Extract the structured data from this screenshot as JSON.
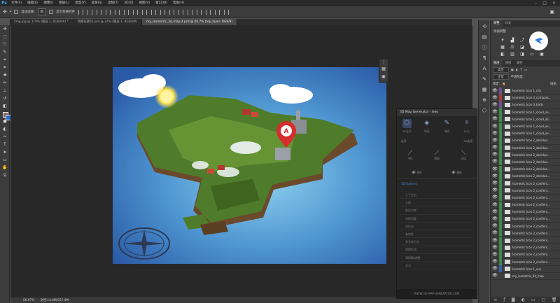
{
  "app": {
    "logo": "Ps"
  },
  "menu": [
    "文件(F)",
    "编辑(E)",
    "图像(I)",
    "图层(L)",
    "类型(Y)",
    "选择(S)",
    "滤镜(T)",
    "3D(D)",
    "视图(V)",
    "窗口(W)",
    "帮助(H)"
  ],
  "options": {
    "auto_select": "自动选择:",
    "auto_select_value": "组",
    "show_transform": "显示变换控件"
  },
  "tabs": [
    {
      "label": "5mg.jpg @ 119% (图层 1, RGB/8#) *",
      "active": false
    },
    {
      "label": "地图标题02.psd @ 24% (图层 1, RGB/8#)",
      "active": false
    },
    {
      "label": "my_isometric_3d_map-2.psd @ 66.7% (top_layer, RGB/8)",
      "active": true
    }
  ],
  "status": {
    "zoom": "66.67%",
    "doc": "文档:14.0M/557.4M"
  },
  "plugin": {
    "title": "3D Map Generator - Geo",
    "tabs": [
      "3D选项",
      "地面",
      "笔刷",
      "标记"
    ],
    "sub": [
      "选项",
      "3D选项"
    ],
    "brush_labels": [
      "平行",
      "斜面",
      "立体"
    ],
    "block_labels": [
      "地形",
      "建筑"
    ],
    "list_header": "3D-Options",
    "list": [
      "上下左右",
      "上坡",
      "前后对称",
      "对称到某",
      "对比分",
      "有效性",
      "多元化方法",
      "地图生成",
      "3D建筑调整",
      "北方"
    ],
    "footer": "WWW.3D-MAP-GENERATOR.COM"
  },
  "right_panel": {
    "top_tabs": [
      "调整",
      "样式"
    ],
    "add_adjustment": "添加调整",
    "layer_tabs": [
      "图层",
      "通道",
      "路径"
    ],
    "filter_kind": "类型",
    "blend_mode": "正常",
    "opacity_label": "不透明度:",
    "lock_label": "锁定:",
    "fill_label": "填充:",
    "layers": [
      {
        "name": "Isometric Icon 1_city",
        "tag": "#6e4f8f"
      },
      {
        "name": "Isometric Icon 4_compass...",
        "tag": "#a33b3b"
      },
      {
        "name": "Isometric Icon 3_birds",
        "tag": "#6e4f8f"
      },
      {
        "name": "Isometric Icon 1_cloud_ov...",
        "tag": "#3b8a4a"
      },
      {
        "name": "Isometric Icon 1_cloud_ali...",
        "tag": "#3b8a4a"
      },
      {
        "name": "Isometric Icon 1_cloud_ov...",
        "tag": "#3b8a4a"
      },
      {
        "name": "Isometric Icon 1_cloud_ov...",
        "tag": "#3b8a4a"
      },
      {
        "name": "Isometric Icon 2_deciduo...",
        "tag": "#3b8a4a"
      },
      {
        "name": "Isometric Icon 2_deciduo...",
        "tag": "#3b8a4a"
      },
      {
        "name": "Isometric Icon 2_deciduo...",
        "tag": "#3b8a4a"
      },
      {
        "name": "Isometric Icon 2_deciduo...",
        "tag": "#3b8a4a"
      },
      {
        "name": "Isometric Icon 2_deciduo...",
        "tag": "#3b8a4a"
      },
      {
        "name": "Isometric Icon 2_deciduo...",
        "tag": "#3b8a4a"
      },
      {
        "name": "Isometric Icon 2_conifers...",
        "tag": "#3b8a4a"
      },
      {
        "name": "Isometric Icon 2_conifers...",
        "tag": "#3b8a4a"
      },
      {
        "name": "Isometric Icon 2_conifers...",
        "tag": "#3b8a4a"
      },
      {
        "name": "Isometric Icon 2_conifers...",
        "tag": "#3b8a4a"
      },
      {
        "name": "Isometric Icon 2_conifers...",
        "tag": "#3b8a4a"
      },
      {
        "name": "Isometric Icon 2_conifers...",
        "tag": "#3b8a4a"
      },
      {
        "name": "Isometric Icon 2_conifers...",
        "tag": "#3b8a4a"
      },
      {
        "name": "Isometric Icon 2_conifers...",
        "tag": "#3b8a4a"
      },
      {
        "name": "Isometric Icon 2_conifers...",
        "tag": "#3b8a4a"
      },
      {
        "name": "Isometric Icon 2_conifers...",
        "tag": "#3b8a4a"
      },
      {
        "name": "Isometric Icon 2_conifers...",
        "tag": "#3b8a4a"
      },
      {
        "name": "Isometric Icon 2_conifers...",
        "tag": "#3b8a4a"
      },
      {
        "name": "Isometric Icon 1_sun",
        "tag": "#3b5fa8"
      },
      {
        "name": "my_isometric_3d_map",
        "tag": "#3c3c3c"
      }
    ]
  },
  "map": {
    "marker_letter": "A"
  },
  "colors": {
    "accent": "#31a8ff",
    "fg_swatch": "#7d5d5b",
    "bg_swatch": "#2a66c4",
    "sea": "#4f7fc0",
    "land": "#4f7c2a"
  }
}
